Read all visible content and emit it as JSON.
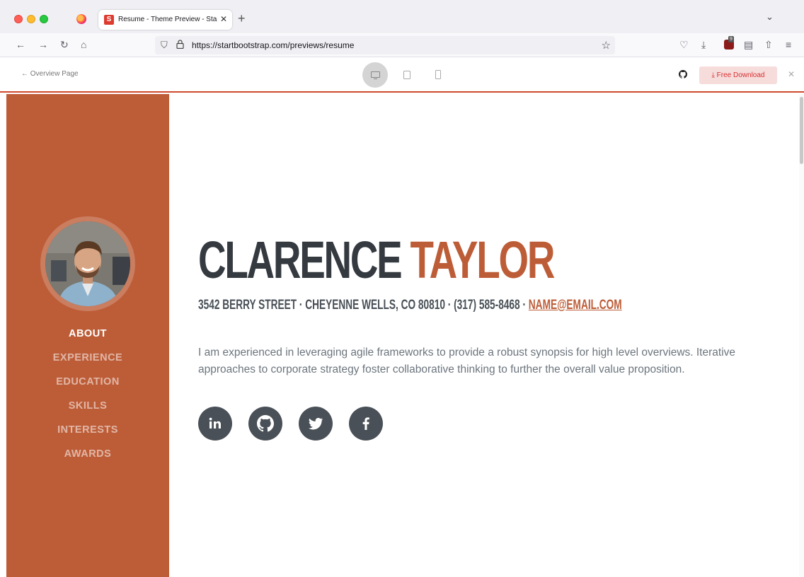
{
  "browser": {
    "tab_title": "Resume - Theme Preview - Start Bootstrap",
    "tab_favicon_letter": "S",
    "url": "https://startbootstrap.com/previews/resume"
  },
  "preview_bar": {
    "back_label": "← Overview Page",
    "download_label": "⤓ Free Download",
    "active_device": "desktop"
  },
  "sidebar": {
    "items": [
      {
        "label": "ABOUT",
        "active": true
      },
      {
        "label": "EXPERIENCE",
        "active": false
      },
      {
        "label": "EDUCATION",
        "active": false
      },
      {
        "label": "SKILLS",
        "active": false
      },
      {
        "label": "INTERESTS",
        "active": false
      },
      {
        "label": "AWARDS",
        "active": false
      }
    ]
  },
  "about": {
    "first_name": "CLARENCE",
    "last_name": "TAYLOR",
    "address": "3542 BERRY STREET · CHEYENNE WELLS, CO 80810 · (317) 585-8468 · ",
    "email": "NAME@EMAIL.COM",
    "lead": "I am experienced in leveraging agile frameworks to provide a robust synopsis for high level overviews. Iterative approaches to corporate strategy foster collaborative thinking to further the overall value proposition."
  },
  "social": [
    "linkedin-icon",
    "github-icon",
    "twitter-icon",
    "facebook-icon"
  ],
  "colors": {
    "primary": "#bd5d38",
    "dark": "#343a40",
    "social_bg": "#495057",
    "text_muted": "#6c757d"
  }
}
